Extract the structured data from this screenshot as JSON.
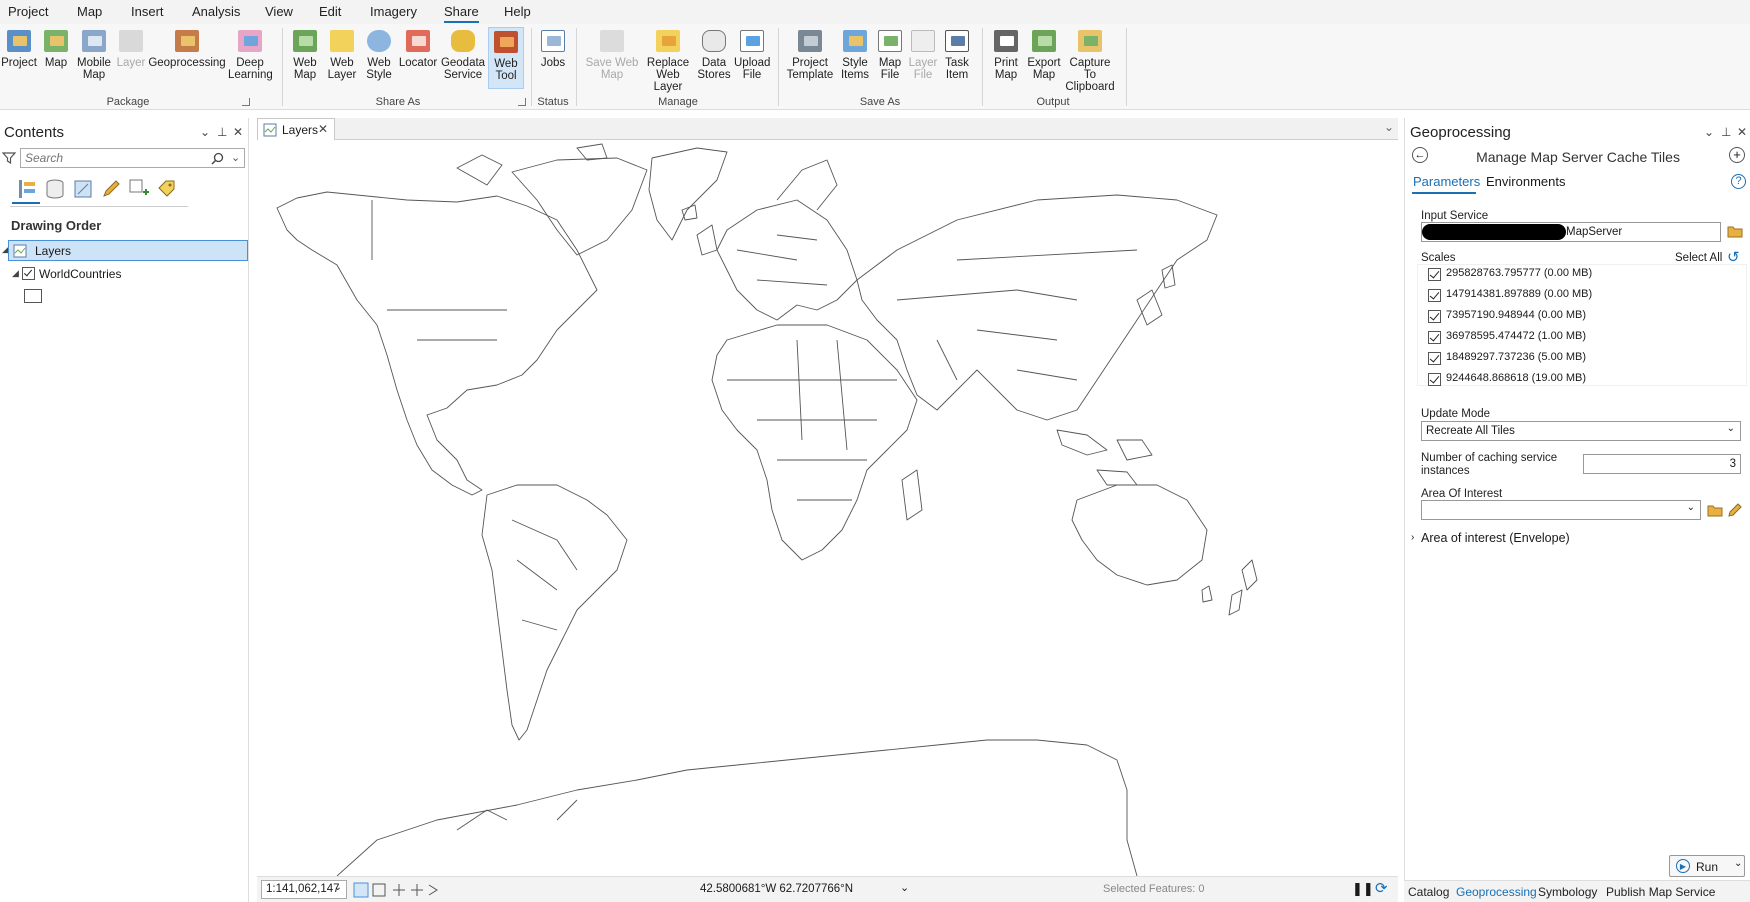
{
  "menu": {
    "tabs": [
      "Project",
      "Map",
      "Insert",
      "Analysis",
      "View",
      "Edit",
      "Imagery",
      "Share",
      "Help"
    ],
    "active": "Share"
  },
  "ribbon": {
    "groups": {
      "package": "Package",
      "share_as": "Share As",
      "status": "Status",
      "manage": "Manage",
      "save_as": "Save As",
      "output": "Output"
    },
    "buttons": {
      "project": "Project",
      "map": "Map",
      "mobile_map": "Mobile Map",
      "layer": "Layer",
      "geoprocessing": "Geoprocessing",
      "deep_learning": "Deep Learning",
      "web_map": "Web Map",
      "web_layer": "Web Layer",
      "web_style": "Web Style",
      "locator": "Locator",
      "geodata_service": "Geodata Service",
      "web_tool": "Web Tool",
      "jobs": "Jobs",
      "save_web_map": "Save Web Map",
      "replace_web_layer": "Replace Web Layer",
      "data_stores": "Data Stores",
      "upload_file": "Upload File",
      "project_template": "Project Template",
      "style_items": "Style Items",
      "map_file": "Map File",
      "layer_file": "Layer File",
      "task_item": "Task Item",
      "print_map": "Print Map",
      "export_map": "Export Map",
      "capture_to_clipboard": "Capture To Clipboard"
    }
  },
  "contents": {
    "title": "Contents",
    "search_placeholder": "Search",
    "section": "Drawing Order",
    "root_layer": "Layers",
    "layer": "WorldCountries"
  },
  "map": {
    "tab_label": "Layers",
    "scale": "1:141,062,147",
    "coordinates": "42.5800681°W 62.7207766°N",
    "selected_features": "Selected Features: 0"
  },
  "geoprocessing": {
    "title": "Geoprocessing",
    "tool_title": "Manage Map Server Cache Tiles",
    "tabs": [
      "Parameters",
      "Environments"
    ],
    "input_service_label": "Input Service",
    "input_service_value": "MapServer",
    "scales_label": "Scales",
    "select_all": "Select All",
    "scales": [
      "295828763.795777 (0.00 MB)",
      "147914381.897889 (0.00 MB)",
      "73957190.948944 (0.00 MB)",
      "36978595.474472 (1.00 MB)",
      "18489297.737236 (5.00 MB)",
      "9244648.868618 (19.00 MB)"
    ],
    "update_mode_label": "Update Mode",
    "update_mode_value": "Recreate All Tiles",
    "instances_label": "Number of caching service instances",
    "instances_value": "3",
    "aoi_label": "Area Of Interest",
    "aoi_envelope": "Area of interest (Envelope)",
    "run": "Run"
  },
  "bottom_tabs": [
    "Catalog",
    "Geoprocessing",
    "Symbology",
    "Publish Map Service"
  ],
  "colors": {
    "accent": "#1a6fb5",
    "selection": "#cde3f7"
  }
}
